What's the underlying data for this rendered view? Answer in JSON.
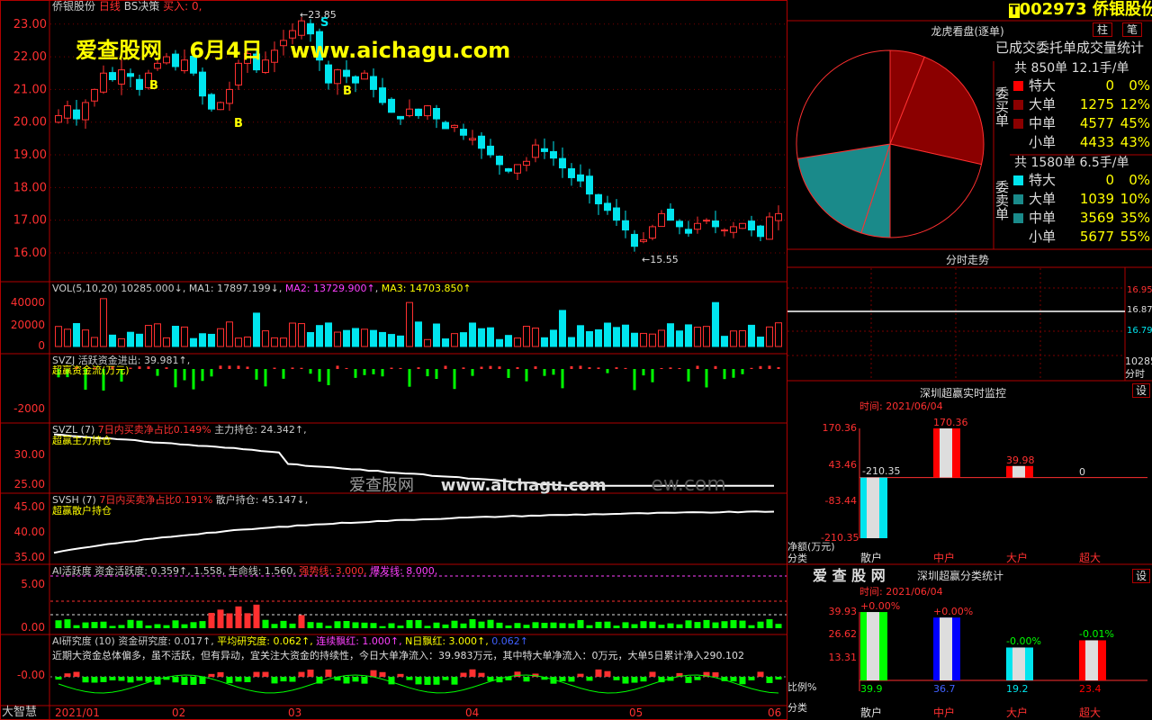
{
  "app": {
    "bottom_logo": "大智慧"
  },
  "header": {
    "stock_name_top": "侨银股份",
    "period": "日线",
    "strategy": "BS决策",
    "buy_label": "买入: 0,",
    "stock_code": "002973",
    "stock_name": "侨银股份",
    "btn_zhu": "柱",
    "btn_bi": "笔",
    "code_marker": "T"
  },
  "watermark": {
    "site": "爱查股网",
    "date": "6月4日",
    "url": "www.aichagu.com",
    "mid_site": "爱查股网",
    "mid_url": "www.aichagu.com",
    "mid_tail": "ew.com"
  },
  "colors": {
    "up": "#ff3030",
    "down": "#00e5ee",
    "axis": "#b00000",
    "grid": "#7a0000",
    "green": "#00ff00",
    "yellow": "#ffff00",
    "magenta": "#ff40ff"
  },
  "chart_data": [
    {
      "type": "candlestick",
      "title": "日线",
      "ylim": [
        15.2,
        23.6
      ],
      "yticks": [
        "23.00",
        "22.00",
        "21.00",
        "20.00",
        "19.00",
        "18.00",
        "17.00",
        "16.00"
      ],
      "x_labels": [
        "2021/01",
        "02",
        "03",
        "04",
        "05",
        "06"
      ],
      "annotations": {
        "high": "23.85",
        "low": "15.55",
        "buy_marker": "B",
        "sell_marker": "S"
      },
      "closes": [
        20.2,
        20.5,
        20.1,
        20.6,
        21.0,
        21.5,
        21.3,
        21.6,
        21.4,
        21.0,
        21.5,
        21.8,
        22.0,
        21.7,
        21.9,
        21.5,
        20.8,
        20.4,
        20.6,
        21.0,
        21.8,
        22.1,
        21.6,
        21.9,
        22.2,
        22.5,
        22.8,
        23.1,
        22.7,
        21.9,
        21.2,
        21.6,
        21.4,
        21.2,
        21.5,
        21.0,
        20.6,
        20.3,
        20.1,
        20.4,
        20.2,
        20.5,
        20.1,
        19.8,
        19.9,
        19.6,
        19.5,
        19.2,
        19.0,
        18.7,
        18.5,
        18.7,
        18.8,
        19.3,
        19.1,
        18.9,
        18.6,
        18.3,
        18.2,
        17.8,
        17.5,
        17.3,
        17.0,
        16.7,
        16.2,
        16.4,
        16.8,
        17.2,
        17.0,
        16.8,
        16.6,
        16.9,
        17.0,
        16.8,
        16.7,
        16.8,
        16.9,
        16.7,
        16.5,
        17.1,
        17.2
      ]
    },
    {
      "type": "bar",
      "title": "VOL(5,10,20)",
      "values_text": {
        "vol": "10285.000↓",
        "ma1": "MA1: 17897.199↓",
        "ma2": "MA2: 13729.900↑",
        "ma3": "MA3: 14703.850↑"
      },
      "yticks": [
        "40000",
        "20000",
        "0"
      ],
      "ylim": [
        0,
        50000
      ]
    },
    {
      "type": "bar",
      "title": "SVZJ",
      "values_text": {
        "main": "活跃资金进出: 39.981↑,"
      },
      "legend": "超赢资金流(万元)",
      "yticks": [
        "-2000"
      ]
    },
    {
      "type": "line",
      "title": "SVZL (7)",
      "values_text": {
        "ratio": "7日内买卖净占比0.149%",
        "hold": "主力持仓: 24.342↑,"
      },
      "legend": "超赢主力持仓",
      "yticks": [
        "30.00",
        "25.00"
      ],
      "ylim": [
        23.5,
        33.5
      ]
    },
    {
      "type": "line",
      "title": "SVSH (7)",
      "values_text": {
        "ratio": "7日内买卖净占比0.191%",
        "hold": "散户持仓: 45.147↓,"
      },
      "legend": "超赢散户持仓",
      "yticks": [
        "45.00",
        "40.00",
        "35.00"
      ],
      "ylim": [
        33.5,
        47.5
      ]
    },
    {
      "type": "bar",
      "title": "AI活跃度",
      "values_text": {
        "active": "资金活跃度: 0.359↑,",
        "v2": "1.558,",
        "life": "生命线: 1.560,",
        "strong": "强势线: 3.000,",
        "burst": "爆发线: 8.000,"
      },
      "yticks": [
        "5.00",
        "0.00"
      ]
    },
    {
      "type": "bar",
      "title": "AI研究度 (10)",
      "values_text": {
        "research": "资金研究度: 0.017↑,",
        "avg": "平均研究度: 0.062↑,",
        "consecutive": "连续飘红: 1.000↑,",
        "nday": "N日飘红: 3.000↑,",
        "last": "0.062↑"
      },
      "comment": "近期大资金总体偏多，虽不活跃，但有异动，宜关注大资金的持续性，今日大单净流入：39.983万元，其中特大单净流入：0万元，大单5日累计净入290.102",
      "yticks": [
        "-0.00"
      ]
    },
    {
      "type": "pie",
      "title": "龙虎看盘(逐单)",
      "subtitle": "已成交委托单成交量统计",
      "slices": [
        {
          "name": "买-特大",
          "value": 0
        },
        {
          "name": "买-大单",
          "value": 12
        },
        {
          "name": "买-中单",
          "value": 45
        },
        {
          "name": "买-小单",
          "value": 43
        },
        {
          "name": "卖-特大",
          "value": 0
        },
        {
          "name": "卖-大单",
          "value": 10
        },
        {
          "name": "卖-中单",
          "value": 35
        },
        {
          "name": "卖-小单",
          "value": 55
        }
      ]
    },
    {
      "type": "line",
      "title": "分时走势",
      "yticks": [
        "16.95",
        "16.87",
        "16.79"
      ],
      "corner_label": "10285",
      "unit_label": "分时"
    },
    {
      "type": "bar",
      "title": "深圳超赢实时监控",
      "time_label": "时间: 2021/06/04",
      "categories": [
        "散户",
        "中户",
        "大户",
        "超大"
      ],
      "values": [
        -210.35,
        170.36,
        39.98,
        0
      ],
      "yticks": [
        "170.36",
        "43.46",
        "-83.44",
        "-210.35"
      ],
      "ylabel": "净额(万元)",
      "xlabel": "分类",
      "settings_btn": "设"
    },
    {
      "type": "bar",
      "title": "深圳超赢分类统计",
      "logo": "爱 查 股 网",
      "time_label": "时间: 2021/06/04",
      "categories": [
        "散户",
        "中户",
        "大户",
        "超大"
      ],
      "values": [
        39.9,
        36.7,
        19.2,
        23.4
      ],
      "changes": [
        "+0.00%",
        "+0.00%",
        "-0.00%",
        "-0.01%"
      ],
      "yticks": [
        "39.93",
        "26.62",
        "13.31"
      ],
      "ylabel": "比例%",
      "xlabel": "分类",
      "settings_btn": "设"
    }
  ],
  "orders_panel": {
    "buy": {
      "side_label": "委买单",
      "total": "共 850单 12.1手/单",
      "rows": [
        {
          "label": "特大",
          "count": "0",
          "pct": "0%"
        },
        {
          "label": "大单",
          "count": "1275",
          "pct": "12%"
        },
        {
          "label": "中单",
          "count": "4577",
          "pct": "45%"
        },
        {
          "label": "小单",
          "count": "4433",
          "pct": "43%"
        }
      ]
    },
    "sell": {
      "side_label": "委卖单",
      "total": "共 1580单 6.5手/单",
      "rows": [
        {
          "label": "特大",
          "count": "0",
          "pct": "0%"
        },
        {
          "label": "大单",
          "count": "1039",
          "pct": "10%"
        },
        {
          "label": "中单",
          "count": "3569",
          "pct": "35%"
        },
        {
          "label": "小单",
          "count": "5677",
          "pct": "55%"
        }
      ]
    }
  }
}
